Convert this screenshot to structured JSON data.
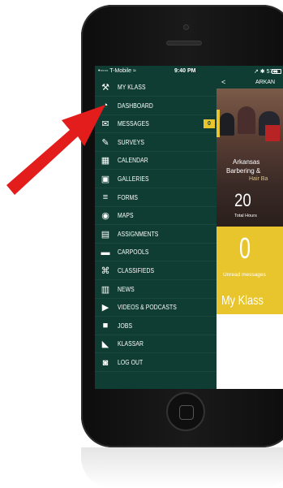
{
  "status_bar": {
    "carrier": "•◦◦◦◦ T-Mobile ≈",
    "time": "9:40 PM",
    "battery": "↗ ✱ 57%"
  },
  "menu": {
    "items": [
      {
        "label": "MY KLASS",
        "icon": "tools-icon",
        "glyph": "⚒"
      },
      {
        "label": "DASHBOARD",
        "icon": "speedometer-icon",
        "glyph": "◔"
      },
      {
        "label": "MESSAGES",
        "icon": "chat-bubbles-icon",
        "glyph": "✉",
        "badge": "0"
      },
      {
        "label": "SURVEYS",
        "icon": "pencil-icon",
        "glyph": "✎"
      },
      {
        "label": "CALENDAR",
        "icon": "calendar-icon",
        "glyph": "▦"
      },
      {
        "label": "GALLERIES",
        "icon": "photo-album-icon",
        "glyph": "▣"
      },
      {
        "label": "FORMS",
        "icon": "layers-icon",
        "glyph": "≡"
      },
      {
        "label": "MAPS",
        "icon": "map-pin-icon",
        "glyph": "◉"
      },
      {
        "label": "ASSIGNMENTS",
        "icon": "document-icon",
        "glyph": "▤"
      },
      {
        "label": "CARPOOLS",
        "icon": "car-icon",
        "glyph": "▬"
      },
      {
        "label": "CLASSIFIEDS",
        "icon": "classifieds-icon",
        "glyph": "⌘"
      },
      {
        "label": "NEWS",
        "icon": "newspaper-icon",
        "glyph": "▥"
      },
      {
        "label": "VIDEOS & PODCASTS",
        "icon": "play-circle-icon",
        "glyph": "▶"
      },
      {
        "label": "JOBS",
        "icon": "briefcase-icon",
        "glyph": "■"
      },
      {
        "label": "KLASSAR",
        "icon": "klassar-icon",
        "glyph": "◣"
      },
      {
        "label": "LOG OUT",
        "icon": "lock-icon",
        "glyph": "◙"
      }
    ]
  },
  "content": {
    "topbar_back": "<",
    "topbar_title": "ARKAN",
    "photo_caption_1": "Arkansas",
    "photo_caption_2": "Barbering &",
    "photo_caption_3": "Hair Ba",
    "total_hours_value": "20",
    "total_hours_label": "Total Hours",
    "unread_value": "0",
    "unread_label": "Unread messages",
    "myklass_label": "My Klass"
  },
  "colors": {
    "menu_bg": "#0f3d33",
    "accent_yellow": "#e8c52c",
    "arrow_red": "#e31c1c"
  }
}
